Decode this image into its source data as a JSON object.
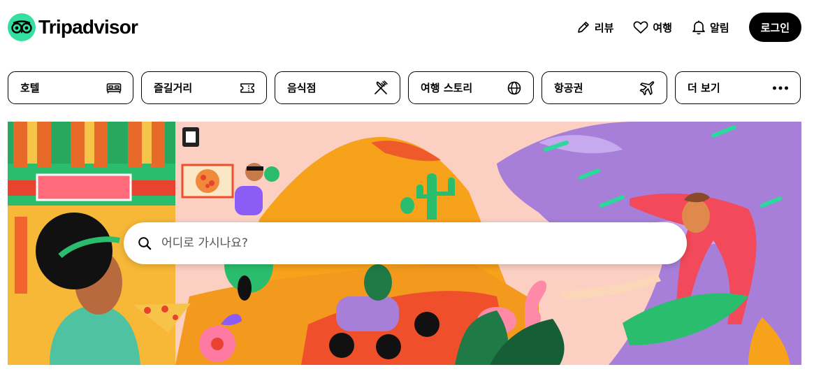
{
  "brand": {
    "name": "Tripadvisor",
    "color": "#34e0a1"
  },
  "nav": {
    "items": [
      {
        "label": "리뷰",
        "icon": "pencil-icon"
      },
      {
        "label": "여행",
        "icon": "heart-icon"
      },
      {
        "label": "알림",
        "icon": "bell-icon"
      }
    ],
    "login_label": "로그인"
  },
  "categories": [
    {
      "label": "호텔",
      "icon": "bed-icon"
    },
    {
      "label": "즐길거리",
      "icon": "ticket-icon"
    },
    {
      "label": "음식점",
      "icon": "utensils-icon"
    },
    {
      "label": "여행 스토리",
      "icon": "globe-icon"
    },
    {
      "label": "항공권",
      "icon": "plane-icon"
    },
    {
      "label": "더 보기",
      "icon": "more-dots-icon"
    }
  ],
  "search": {
    "placeholder": "어디로 가시나요?",
    "value": "",
    "icon": "search-icon"
  },
  "colors": {
    "accent": "#34e0a1",
    "hero_pink": "#fbd0c3",
    "hero_orange": "#f7a21b",
    "hero_purple": "#a77fd9",
    "hero_green": "#2bbd6e"
  }
}
